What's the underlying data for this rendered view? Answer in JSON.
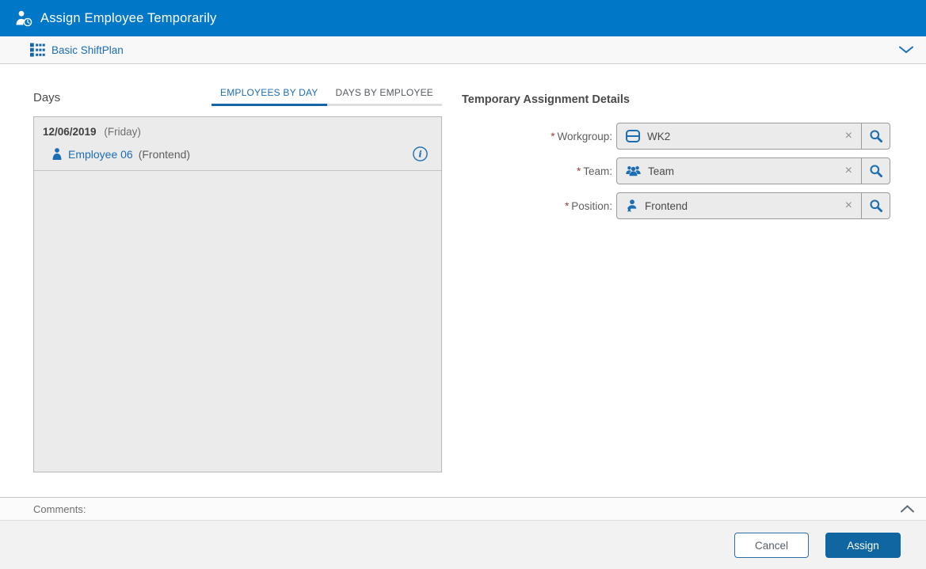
{
  "header": {
    "title": "Assign Employee Temporarily",
    "icon": "assign-employee-temporarily-icon"
  },
  "shiftplan_bar": {
    "label": "Basic ShiftPlan",
    "icon": "shiftplan-grid-icon",
    "collapse_icon": "chevron-down-icon"
  },
  "days_section": {
    "label": "Days",
    "tabs": [
      {
        "label": "EMPLOYEES BY DAY",
        "active": true
      },
      {
        "label": "DAYS BY EMPLOYEE",
        "active": false
      }
    ],
    "day_groups": [
      {
        "date": "12/06/2019",
        "day_name": "(Friday)",
        "employees": [
          {
            "name": "Employee 06",
            "position": "(Frontend)",
            "icon": "person-icon",
            "info_icon": "info-icon"
          }
        ]
      }
    ]
  },
  "details_section": {
    "title": "Temporary Assignment Details",
    "required_marker": "*",
    "fields": [
      {
        "label": "Workgroup:",
        "value": "WK2",
        "icon": "workgroup-icon"
      },
      {
        "label": "Team:",
        "value": "Team",
        "icon": "team-icon"
      },
      {
        "label": "Position:",
        "value": "Frontend",
        "icon": "position-icon"
      }
    ]
  },
  "icons": {
    "clear_glyph": "×"
  },
  "comments_bar": {
    "label": "Comments:",
    "collapse_icon": "chevron-up-icon"
  },
  "footer": {
    "cancel_label": "Cancel",
    "assign_label": "Assign"
  },
  "colors": {
    "header_blue": "#0077c7",
    "accent_blue": "#1c6eb4",
    "tab_underline_blue": "#1465a7",
    "assign_button_blue": "#0f66a0",
    "required_red": "#a0403c",
    "panel_gray": "#ebebeb"
  }
}
